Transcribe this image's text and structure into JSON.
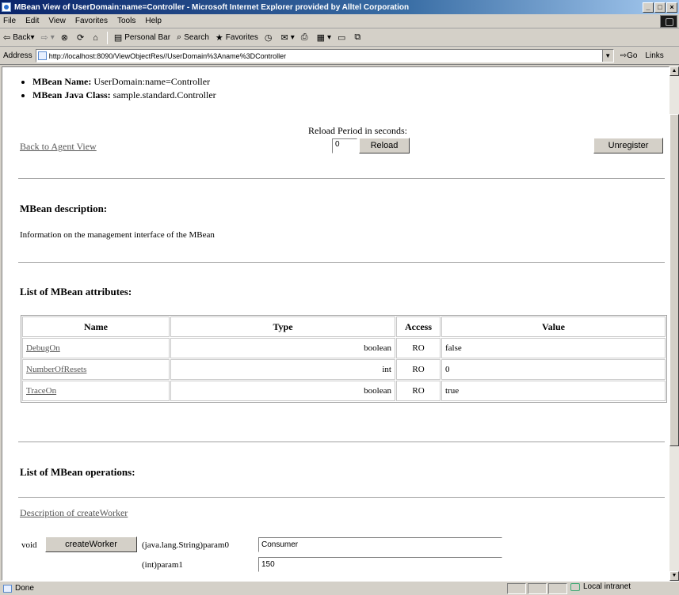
{
  "window": {
    "title": "MBean View of UserDomain:name=Controller - Microsoft Internet Explorer provided by Alltel Corporation",
    "min": "_",
    "max": "□",
    "close": "×"
  },
  "menu": {
    "items": [
      "File",
      "Edit",
      "View",
      "Favorites",
      "Tools",
      "Help"
    ]
  },
  "toolbar": {
    "back": "Back",
    "forward": "",
    "stop": "",
    "refresh": "",
    "home": "",
    "personal_bar": "Personal Bar",
    "search": "Search",
    "favorites": "Favorites"
  },
  "address": {
    "label": "Address",
    "url": "http://localhost:8090/ViewObjectRes//UserDomain%3Aname%3DController",
    "go": "Go",
    "links": "Links"
  },
  "page": {
    "mbean_name_label": "MBean Name:",
    "mbean_name_value": "UserDomain:name=Controller",
    "mbean_class_label": "MBean Java Class:",
    "mbean_class_value": "sample.standard.Controller",
    "back_link": "Back to Agent View",
    "reload_label": "Reload Period in seconds:",
    "reload_value": "0",
    "reload_button": "Reload",
    "unregister_button": "Unregister",
    "desc_heading": "MBean description:",
    "desc_text": "Information on the management interface of the MBean",
    "attrs_heading": "List of MBean attributes:",
    "attrs_columns": [
      "Name",
      "Type",
      "Access",
      "Value"
    ],
    "attrs_rows": [
      {
        "name": "DebugOn",
        "type": "boolean",
        "access": "RO",
        "value": "false"
      },
      {
        "name": "NumberOfResets",
        "type": "int",
        "access": "RO",
        "value": "0"
      },
      {
        "name": "TraceOn",
        "type": "boolean",
        "access": "RO",
        "value": "true"
      }
    ],
    "ops_heading": "List of MBean operations:",
    "op_desc_link": "Description of createWorker",
    "op_return": "void",
    "op_button": "createWorker",
    "op_param0_label": "(java.lang.String)param0",
    "op_param0_value": "Consumer",
    "op_param1_label": "(int)param1",
    "op_param1_value": "150"
  },
  "status": {
    "text": "Done",
    "zone": "Local intranet"
  }
}
